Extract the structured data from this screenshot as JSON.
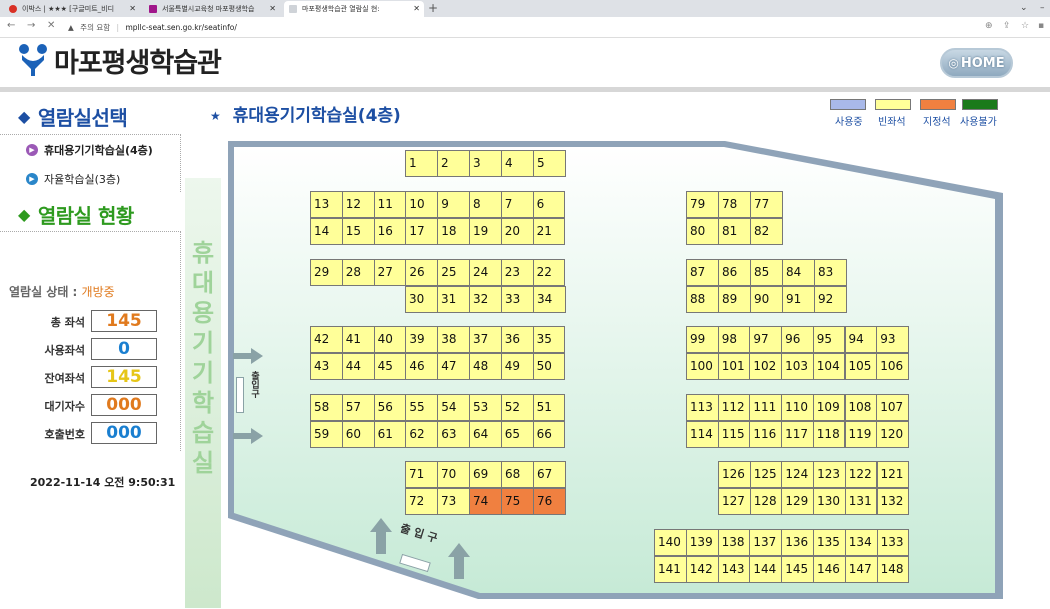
{
  "browser": {
    "tabs": [
      {
        "title": "이박스 | ★★★ [구글미트_비디",
        "color": "#d93025"
      },
      {
        "title": "서울특별시교육청 마포평생학습",
        "color": "#a0168a"
      },
      {
        "title": "마포평생학습관 열람실 현:",
        "color": "#9aa0a6"
      }
    ],
    "new_tab": "+",
    "security": "주의 요함",
    "url": "mpllc-seat.sen.go.kr/seatinfo/"
  },
  "header": {
    "logo_text": "마포평생학습관",
    "home_label": "HOME"
  },
  "sidebar": {
    "select_title": "열람실선택",
    "rooms": [
      {
        "label": "휴대용기기학습실(4층)",
        "selected": true
      },
      {
        "label": "자율학습실(3층)",
        "selected": false
      }
    ],
    "status_title": "열람실 현황",
    "status_label": "열람실 상태 :",
    "status_value": "개방중",
    "stats": [
      {
        "label": "총 좌석",
        "value": "145",
        "color": "#e07a1e"
      },
      {
        "label": "사용좌석",
        "value": "0",
        "color": "#1a7fd0"
      },
      {
        "label": "잔여좌석",
        "value": "145",
        "color": "#e6c617"
      },
      {
        "label": "대기자수",
        "value": "000",
        "color": "#e07a1e"
      },
      {
        "label": "호출번호",
        "value": "000",
        "color": "#1a7fd0"
      }
    ],
    "datetime": "2022-11-14 오전 9:50:31"
  },
  "room": {
    "title": "휴대용기기학습실(4층)",
    "vertical_title": [
      "휴",
      "대",
      "용",
      "기",
      "기",
      "학",
      "습",
      "실"
    ],
    "exit_side": "출입구",
    "entrance": "출 입 구"
  },
  "legend": [
    {
      "label": "사용중",
      "color": "#a9b9e9"
    },
    {
      "label": "빈좌석",
      "color": "#ffff99"
    },
    {
      "label": "지정석",
      "color": "#f08040"
    },
    {
      "label": "사용불가",
      "color": "#1a7a1a"
    }
  ],
  "seats": {
    "available_color": "#ffff99",
    "reserved_color": "#f08040",
    "reserved": [
      74,
      75,
      76
    ],
    "rows": [
      [
        "1",
        "2",
        "3",
        "4",
        "5"
      ],
      [
        "13",
        "12",
        "11",
        "10",
        "9",
        "8",
        "7",
        "6"
      ],
      [
        "14",
        "15",
        "16",
        "17",
        "18",
        "19",
        "20",
        "21"
      ],
      [
        "29",
        "28",
        "27",
        "26",
        "25",
        "24",
        "23",
        "22"
      ],
      [
        "30",
        "31",
        "32",
        "33",
        "34"
      ],
      [
        "42",
        "41",
        "40",
        "39",
        "38",
        "37",
        "36",
        "35"
      ],
      [
        "43",
        "44",
        "45",
        "46",
        "47",
        "48",
        "49",
        "50"
      ],
      [
        "58",
        "57",
        "56",
        "55",
        "54",
        "53",
        "52",
        "51"
      ],
      [
        "59",
        "60",
        "61",
        "62",
        "63",
        "64",
        "65",
        "66"
      ],
      [
        "71",
        "70",
        "69",
        "68",
        "67"
      ],
      [
        "72",
        "73",
        "74",
        "75",
        "76"
      ],
      [
        "79",
        "78",
        "77"
      ],
      [
        "80",
        "81",
        "82"
      ],
      [
        "87",
        "86",
        "85",
        "84",
        "83"
      ],
      [
        "88",
        "89",
        "90",
        "91",
        "92"
      ],
      [
        "99",
        "98",
        "97",
        "96",
        "95",
        "94",
        "93"
      ],
      [
        "100",
        "101",
        "102",
        "103",
        "104",
        "105",
        "106"
      ],
      [
        "113",
        "112",
        "111",
        "110",
        "109",
        "108",
        "107"
      ],
      [
        "114",
        "115",
        "116",
        "117",
        "118",
        "119",
        "120"
      ],
      [
        "126",
        "125",
        "124",
        "123",
        "122",
        "121"
      ],
      [
        "127",
        "128",
        "129",
        "130",
        "131",
        "132"
      ],
      [
        "140",
        "139",
        "138",
        "137",
        "136",
        "135",
        "134",
        "133"
      ],
      [
        "141",
        "142",
        "143",
        "144",
        "145",
        "146",
        "147",
        "148"
      ]
    ]
  }
}
